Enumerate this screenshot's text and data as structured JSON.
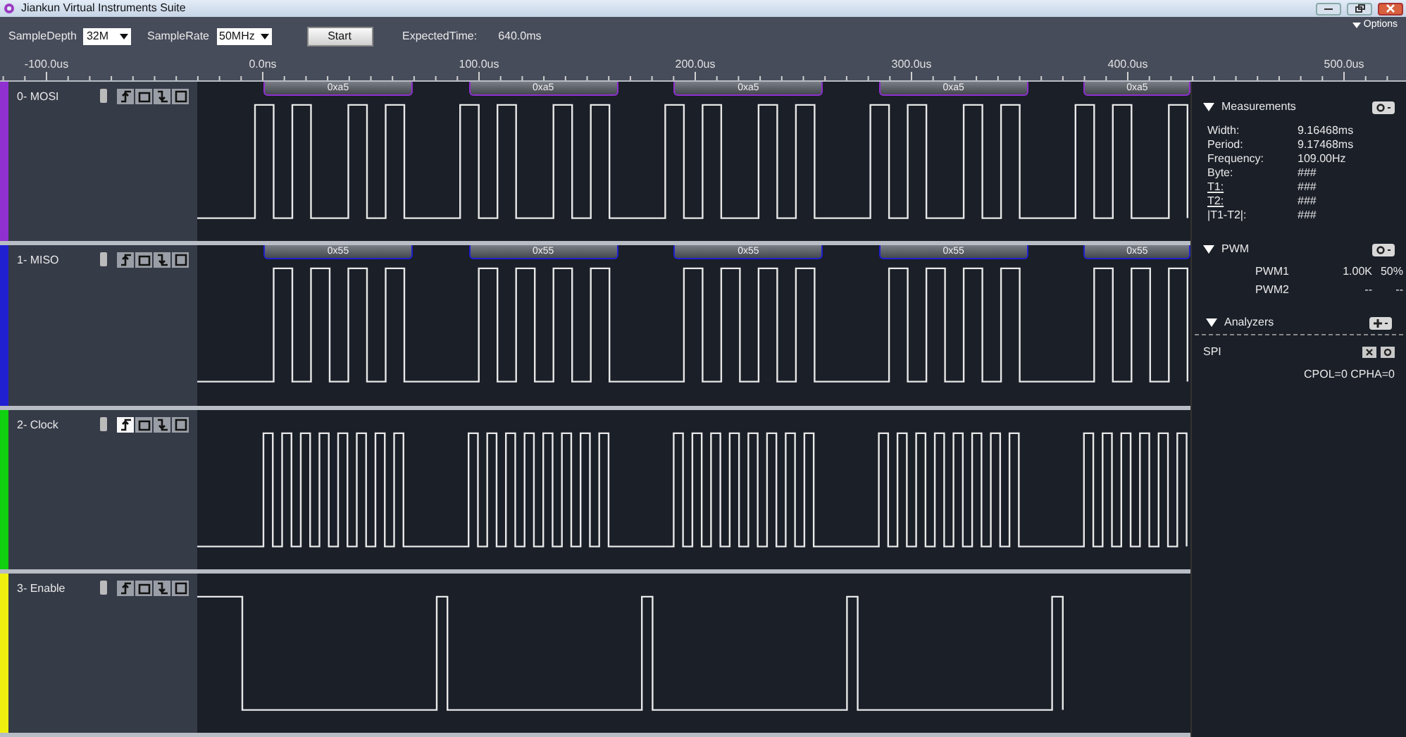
{
  "window": {
    "title": "Jiankun Virtual Instruments Suite"
  },
  "toolbar": {
    "sample_depth": {
      "label": "SampleDepth",
      "value": "32M"
    },
    "sample_rate": {
      "label": "SampleRate",
      "value": "50MHz"
    },
    "start_button": "Start",
    "expected_time": {
      "label": "ExpectedTime:",
      "value": "640.0ms"
    },
    "options": "Options"
  },
  "ruler": {
    "labels": [
      "-100.0us",
      "0.0ns",
      "100.0us",
      "200.0us",
      "300.0us",
      "400.0us",
      "500.0us"
    ]
  },
  "channels": [
    {
      "name": "0- MOSI",
      "color": "#9030d0",
      "trigger_buttons": [
        {
          "kind": "rising",
          "selected": false
        },
        {
          "kind": "high",
          "selected": false
        },
        {
          "kind": "falling",
          "selected": false
        },
        {
          "kind": "low",
          "selected": false
        }
      ],
      "decoded": [
        "0xa5",
        "0xa5",
        "0xa5",
        "0xa5",
        "0xa5"
      ]
    },
    {
      "name": "1- MISO",
      "color": "#2020d0",
      "trigger_buttons": [
        {
          "kind": "rising",
          "selected": false
        },
        {
          "kind": "high",
          "selected": false
        },
        {
          "kind": "falling",
          "selected": false
        },
        {
          "kind": "low",
          "selected": false
        }
      ],
      "decoded": [
        "0x55",
        "0x55",
        "0x55",
        "0x55",
        "0x55"
      ]
    },
    {
      "name": "2- Clock",
      "color": "#10d010",
      "trigger_buttons": [
        {
          "kind": "rising",
          "selected": true
        },
        {
          "kind": "high",
          "selected": false
        },
        {
          "kind": "falling",
          "selected": false
        },
        {
          "kind": "low",
          "selected": false
        }
      ]
    },
    {
      "name": "3- Enable",
      "color": "#f0f010",
      "trigger_buttons": [
        {
          "kind": "rising",
          "selected": false
        },
        {
          "kind": "high",
          "selected": false
        },
        {
          "kind": "falling",
          "selected": false
        },
        {
          "kind": "low",
          "selected": false
        }
      ]
    }
  ],
  "measurements": {
    "title": "Measurements",
    "rows": [
      {
        "label": "Width:",
        "value": "9.16468ms",
        "underlined": false
      },
      {
        "label": "Period:",
        "value": "9.17468ms",
        "underlined": false
      },
      {
        "label": "Frequency:",
        "value": "109.00Hz",
        "underlined": false
      },
      {
        "label": "Byte:",
        "value": "###",
        "underlined": false
      },
      {
        "label": "T1:",
        "value": "###",
        "underlined": true
      },
      {
        "label": "T2:",
        "value": "###",
        "underlined": true
      },
      {
        "label": "|T1-T2|:",
        "value": "###",
        "underlined": false
      }
    ]
  },
  "pwm": {
    "title": "PWM",
    "rows": [
      {
        "name": "PWM1",
        "frequency": "1.00K",
        "duty": "50%"
      },
      {
        "name": "PWM2",
        "frequency": "--",
        "duty": "--"
      }
    ]
  },
  "analyzers": {
    "title": "Analyzers",
    "items": [
      {
        "name": "SPI",
        "settings": "CPOL=0 CPHA=0"
      }
    ]
  }
}
